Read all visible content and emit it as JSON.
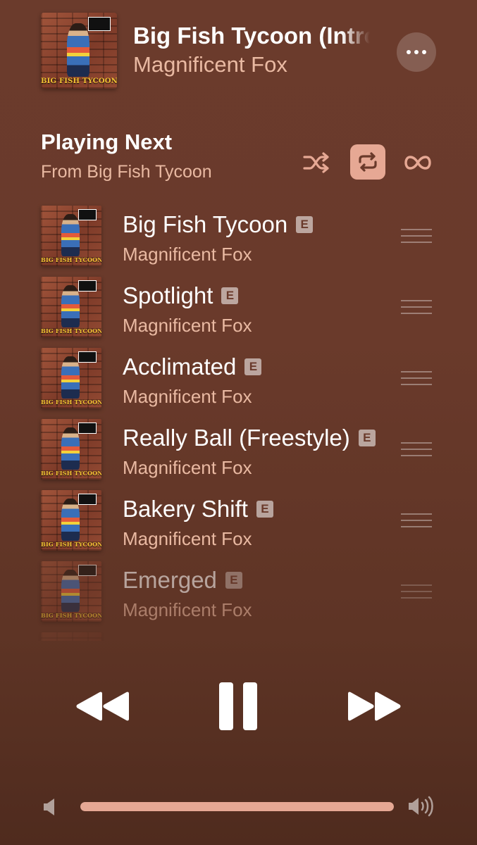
{
  "now_playing": {
    "title": "Big Fish Tycoon (Intro)",
    "artist": "Magnificent Fox",
    "album_art_caption": "BIG FISH TYCOON",
    "more_icon": "ellipsis-icon"
  },
  "queue": {
    "heading": "Playing Next",
    "source": "From Big Fish Tycoon",
    "controls": {
      "shuffle_icon": "shuffle-icon",
      "repeat_icon": "repeat-icon",
      "repeat_active": true,
      "autoplay_icon": "infinity-icon"
    },
    "explicit_badge": "E",
    "items": [
      {
        "title": "Big Fish Tycoon",
        "artist": "Magnificent Fox",
        "explicit": true
      },
      {
        "title": "Spotlight",
        "artist": "Magnificent Fox",
        "explicit": true
      },
      {
        "title": "Acclimated",
        "artist": "Magnificent Fox",
        "explicit": true
      },
      {
        "title": "Really Ball (Freestyle)",
        "artist": "Magnificent Fox",
        "explicit": true
      },
      {
        "title": "Bakery Shift",
        "artist": "Magnificent Fox",
        "explicit": true
      },
      {
        "title": "Emerged",
        "artist": "Magnificent Fox",
        "explicit": true
      }
    ]
  },
  "playback": {
    "state": "playing",
    "rewind_icon": "rewind-icon",
    "pause_icon": "pause-icon",
    "forward_icon": "fast-forward-icon"
  },
  "volume": {
    "level": 1.0,
    "low_icon": "speaker-low-icon",
    "high_icon": "speaker-high-icon"
  },
  "colors": {
    "accent": "#e6a894",
    "secondary_text": "#e9b9a2",
    "background_top": "#6b3b2c",
    "background_bottom": "#4f2b1e"
  }
}
